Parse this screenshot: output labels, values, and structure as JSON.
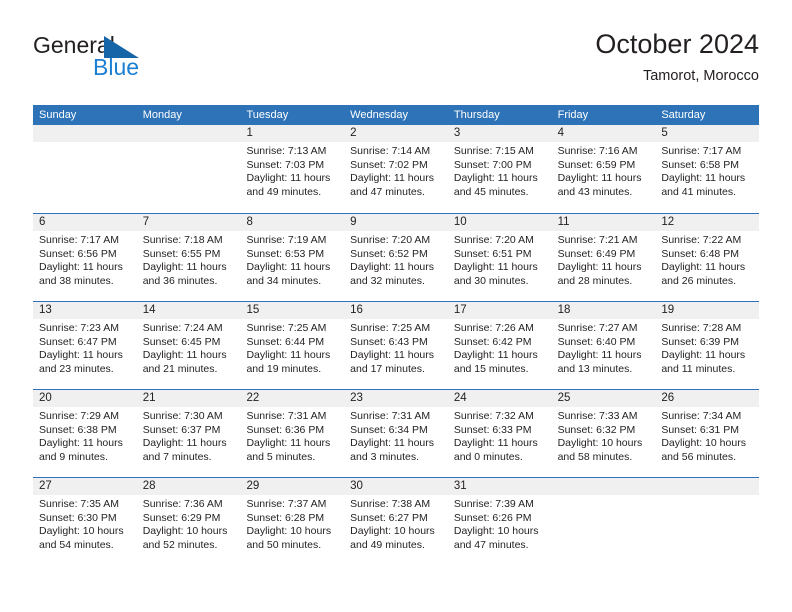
{
  "brand": {
    "name_top": "General",
    "name_bottom": "Blue",
    "flag_icon": "triangle-flag-icon",
    "colors": {
      "general": "#231f20",
      "blue": "#1b7fd4",
      "flag": "#1565a8"
    }
  },
  "header": {
    "title": "October 2024",
    "subtitle": "Tamorot, Morocco"
  },
  "theme": {
    "header_blue": "#2e73b8",
    "day_band_gray": "#f0f0f0",
    "text": "#231f20"
  },
  "calendar": {
    "weekdays": [
      "Sunday",
      "Monday",
      "Tuesday",
      "Wednesday",
      "Thursday",
      "Friday",
      "Saturday"
    ],
    "weeks": [
      [
        {
          "day": "",
          "lines": []
        },
        {
          "day": "",
          "lines": []
        },
        {
          "day": "1",
          "lines": [
            "Sunrise: 7:13 AM",
            "Sunset: 7:03 PM",
            "Daylight: 11 hours",
            "and 49 minutes."
          ]
        },
        {
          "day": "2",
          "lines": [
            "Sunrise: 7:14 AM",
            "Sunset: 7:02 PM",
            "Daylight: 11 hours",
            "and 47 minutes."
          ]
        },
        {
          "day": "3",
          "lines": [
            "Sunrise: 7:15 AM",
            "Sunset: 7:00 PM",
            "Daylight: 11 hours",
            "and 45 minutes."
          ]
        },
        {
          "day": "4",
          "lines": [
            "Sunrise: 7:16 AM",
            "Sunset: 6:59 PM",
            "Daylight: 11 hours",
            "and 43 minutes."
          ]
        },
        {
          "day": "5",
          "lines": [
            "Sunrise: 7:17 AM",
            "Sunset: 6:58 PM",
            "Daylight: 11 hours",
            "and 41 minutes."
          ]
        }
      ],
      [
        {
          "day": "6",
          "lines": [
            "Sunrise: 7:17 AM",
            "Sunset: 6:56 PM",
            "Daylight: 11 hours",
            "and 38 minutes."
          ]
        },
        {
          "day": "7",
          "lines": [
            "Sunrise: 7:18 AM",
            "Sunset: 6:55 PM",
            "Daylight: 11 hours",
            "and 36 minutes."
          ]
        },
        {
          "day": "8",
          "lines": [
            "Sunrise: 7:19 AM",
            "Sunset: 6:53 PM",
            "Daylight: 11 hours",
            "and 34 minutes."
          ]
        },
        {
          "day": "9",
          "lines": [
            "Sunrise: 7:20 AM",
            "Sunset: 6:52 PM",
            "Daylight: 11 hours",
            "and 32 minutes."
          ]
        },
        {
          "day": "10",
          "lines": [
            "Sunrise: 7:20 AM",
            "Sunset: 6:51 PM",
            "Daylight: 11 hours",
            "and 30 minutes."
          ]
        },
        {
          "day": "11",
          "lines": [
            "Sunrise: 7:21 AM",
            "Sunset: 6:49 PM",
            "Daylight: 11 hours",
            "and 28 minutes."
          ]
        },
        {
          "day": "12",
          "lines": [
            "Sunrise: 7:22 AM",
            "Sunset: 6:48 PM",
            "Daylight: 11 hours",
            "and 26 minutes."
          ]
        }
      ],
      [
        {
          "day": "13",
          "lines": [
            "Sunrise: 7:23 AM",
            "Sunset: 6:47 PM",
            "Daylight: 11 hours",
            "and 23 minutes."
          ]
        },
        {
          "day": "14",
          "lines": [
            "Sunrise: 7:24 AM",
            "Sunset: 6:45 PM",
            "Daylight: 11 hours",
            "and 21 minutes."
          ]
        },
        {
          "day": "15",
          "lines": [
            "Sunrise: 7:25 AM",
            "Sunset: 6:44 PM",
            "Daylight: 11 hours",
            "and 19 minutes."
          ]
        },
        {
          "day": "16",
          "lines": [
            "Sunrise: 7:25 AM",
            "Sunset: 6:43 PM",
            "Daylight: 11 hours",
            "and 17 minutes."
          ]
        },
        {
          "day": "17",
          "lines": [
            "Sunrise: 7:26 AM",
            "Sunset: 6:42 PM",
            "Daylight: 11 hours",
            "and 15 minutes."
          ]
        },
        {
          "day": "18",
          "lines": [
            "Sunrise: 7:27 AM",
            "Sunset: 6:40 PM",
            "Daylight: 11 hours",
            "and 13 minutes."
          ]
        },
        {
          "day": "19",
          "lines": [
            "Sunrise: 7:28 AM",
            "Sunset: 6:39 PM",
            "Daylight: 11 hours",
            "and 11 minutes."
          ]
        }
      ],
      [
        {
          "day": "20",
          "lines": [
            "Sunrise: 7:29 AM",
            "Sunset: 6:38 PM",
            "Daylight: 11 hours",
            "and 9 minutes."
          ]
        },
        {
          "day": "21",
          "lines": [
            "Sunrise: 7:30 AM",
            "Sunset: 6:37 PM",
            "Daylight: 11 hours",
            "and 7 minutes."
          ]
        },
        {
          "day": "22",
          "lines": [
            "Sunrise: 7:31 AM",
            "Sunset: 6:36 PM",
            "Daylight: 11 hours",
            "and 5 minutes."
          ]
        },
        {
          "day": "23",
          "lines": [
            "Sunrise: 7:31 AM",
            "Sunset: 6:34 PM",
            "Daylight: 11 hours",
            "and 3 minutes."
          ]
        },
        {
          "day": "24",
          "lines": [
            "Sunrise: 7:32 AM",
            "Sunset: 6:33 PM",
            "Daylight: 11 hours",
            "and 0 minutes."
          ]
        },
        {
          "day": "25",
          "lines": [
            "Sunrise: 7:33 AM",
            "Sunset: 6:32 PM",
            "Daylight: 10 hours",
            "and 58 minutes."
          ]
        },
        {
          "day": "26",
          "lines": [
            "Sunrise: 7:34 AM",
            "Sunset: 6:31 PM",
            "Daylight: 10 hours",
            "and 56 minutes."
          ]
        }
      ],
      [
        {
          "day": "27",
          "lines": [
            "Sunrise: 7:35 AM",
            "Sunset: 6:30 PM",
            "Daylight: 10 hours",
            "and 54 minutes."
          ]
        },
        {
          "day": "28",
          "lines": [
            "Sunrise: 7:36 AM",
            "Sunset: 6:29 PM",
            "Daylight: 10 hours",
            "and 52 minutes."
          ]
        },
        {
          "day": "29",
          "lines": [
            "Sunrise: 7:37 AM",
            "Sunset: 6:28 PM",
            "Daylight: 10 hours",
            "and 50 minutes."
          ]
        },
        {
          "day": "30",
          "lines": [
            "Sunrise: 7:38 AM",
            "Sunset: 6:27 PM",
            "Daylight: 10 hours",
            "and 49 minutes."
          ]
        },
        {
          "day": "31",
          "lines": [
            "Sunrise: 7:39 AM",
            "Sunset: 6:26 PM",
            "Daylight: 10 hours",
            "and 47 minutes."
          ]
        },
        {
          "day": "",
          "lines": []
        },
        {
          "day": "",
          "lines": []
        }
      ]
    ]
  }
}
